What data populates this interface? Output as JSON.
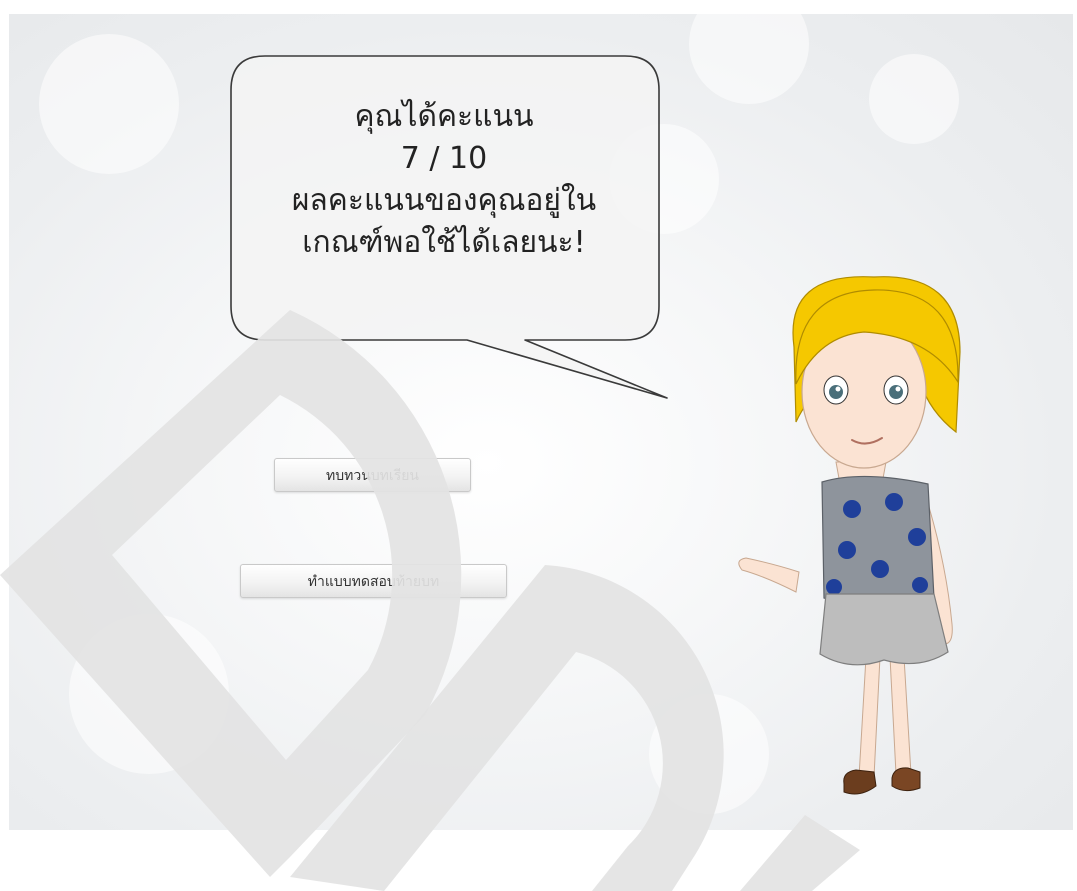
{
  "speech_bubble": {
    "line1": "คุณได้คะแนน",
    "score": "7 / 10",
    "line3": "ผลคะแนนของคุณอยู่ใน",
    "line4": "เกณฑ์พอใช้ได้เลยนะ!"
  },
  "buttons": {
    "review_label": "ทบทวนบทเรียน",
    "quiz_label": "ทำแบบทดสอบท้ายบท"
  },
  "colors": {
    "hair": "#f5c800",
    "top": "#8e949c",
    "dots": "#1f3f9a",
    "skirt": "#bdbdbd",
    "shoes": "#6b3d1e",
    "watermark": "#e3e3e3"
  },
  "watermark": {
    "icon": "dp-watermark-icon"
  }
}
